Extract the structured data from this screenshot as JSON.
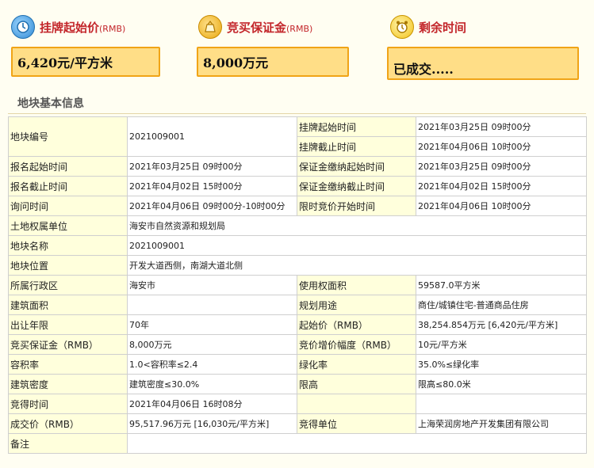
{
  "headers": {
    "start_price": {
      "label": "挂牌起始价",
      "unit": "(RMB)",
      "value": "6,420元/平方米"
    },
    "deposit": {
      "label": "竞买保证金",
      "unit": "(RMB)",
      "value": "8,000万元"
    },
    "remaining": {
      "label": "剩余时间",
      "value": "已成交....."
    }
  },
  "section_title": "地块基本信息",
  "table": {
    "r1": {
      "k1": "地块编号",
      "v1": "2021009001",
      "k2a": "挂牌起始时间",
      "v2a": "2021年03月25日 09时00分",
      "k2b": "挂牌截止时间",
      "v2b": "2021年04月06日 10时00分"
    },
    "r2": {
      "k1": "报名起始时间",
      "v1": "2021年03月25日 09时00分",
      "k2": "保证金缴纳起始时间",
      "v2": "2021年03月25日 09时00分"
    },
    "r3": {
      "k1": "报名截止时间",
      "v1": "2021年04月02日 15时00分",
      "k2": "保证金缴纳截止时间",
      "v2": "2021年04月02日 15时00分"
    },
    "r4": {
      "k1": "询问时间",
      "v1": "2021年04月06日 09时00分-10时00分",
      "k2": "限时竞价开始时间",
      "v2": "2021年04月06日 10时00分"
    },
    "r5": {
      "k1": "土地权属单位",
      "v1": "海安市自然资源和规划局"
    },
    "r6": {
      "k1": "地块名称",
      "v1": "2021009001"
    },
    "r7": {
      "k1": "地块位置",
      "v1": "开发大道西侧，南湖大道北侧"
    },
    "r8": {
      "k1": "所属行政区",
      "v1": "海安市",
      "k2": "使用权面积",
      "v2": "59587.0平方米"
    },
    "r9": {
      "k1": "建筑面积",
      "v1": "",
      "k2": "规划用途",
      "v2": "商住/城镇住宅-普通商品住房"
    },
    "r10": {
      "k1": "出让年限",
      "v1": "70年",
      "k2": "起始价（RMB）",
      "v2": "38,254.854万元 [6,420元/平方米]"
    },
    "r11": {
      "k1": "竞买保证金（RMB）",
      "v1": "8,000万元",
      "k2": "竞价增价幅度（RMB）",
      "v2": "10元/平方米"
    },
    "r12": {
      "k1": "容积率",
      "v1": "1.0<容积率≤2.4",
      "k2": "绿化率",
      "v2": "35.0%≤绿化率"
    },
    "r13": {
      "k1": "建筑密度",
      "v1": "建筑密度≤30.0%",
      "k2": "限高",
      "v2": "限高≤80.0米"
    },
    "r14": {
      "k1": "竞得时间",
      "v1": "2021年04月06日 16时08分",
      "k2": "",
      "v2": ""
    },
    "r15": {
      "k1": "成交价（RMB）",
      "v1": "95,517.96万元 [16,030元/平方米]",
      "k2": "竞得单位",
      "v2": "上海荣润房地产开发集团有限公司"
    },
    "r16": {
      "k1": "备注",
      "v1": ""
    }
  },
  "icons": {
    "start_price": "clock-price-icon",
    "deposit": "money-bag-icon",
    "remaining": "alarm-clock-icon"
  },
  "colors": {
    "accent_red": "#c3262b",
    "box_fill": "#ffde87",
    "box_border": "#f0a417",
    "label_bg": "#ffffdc"
  }
}
